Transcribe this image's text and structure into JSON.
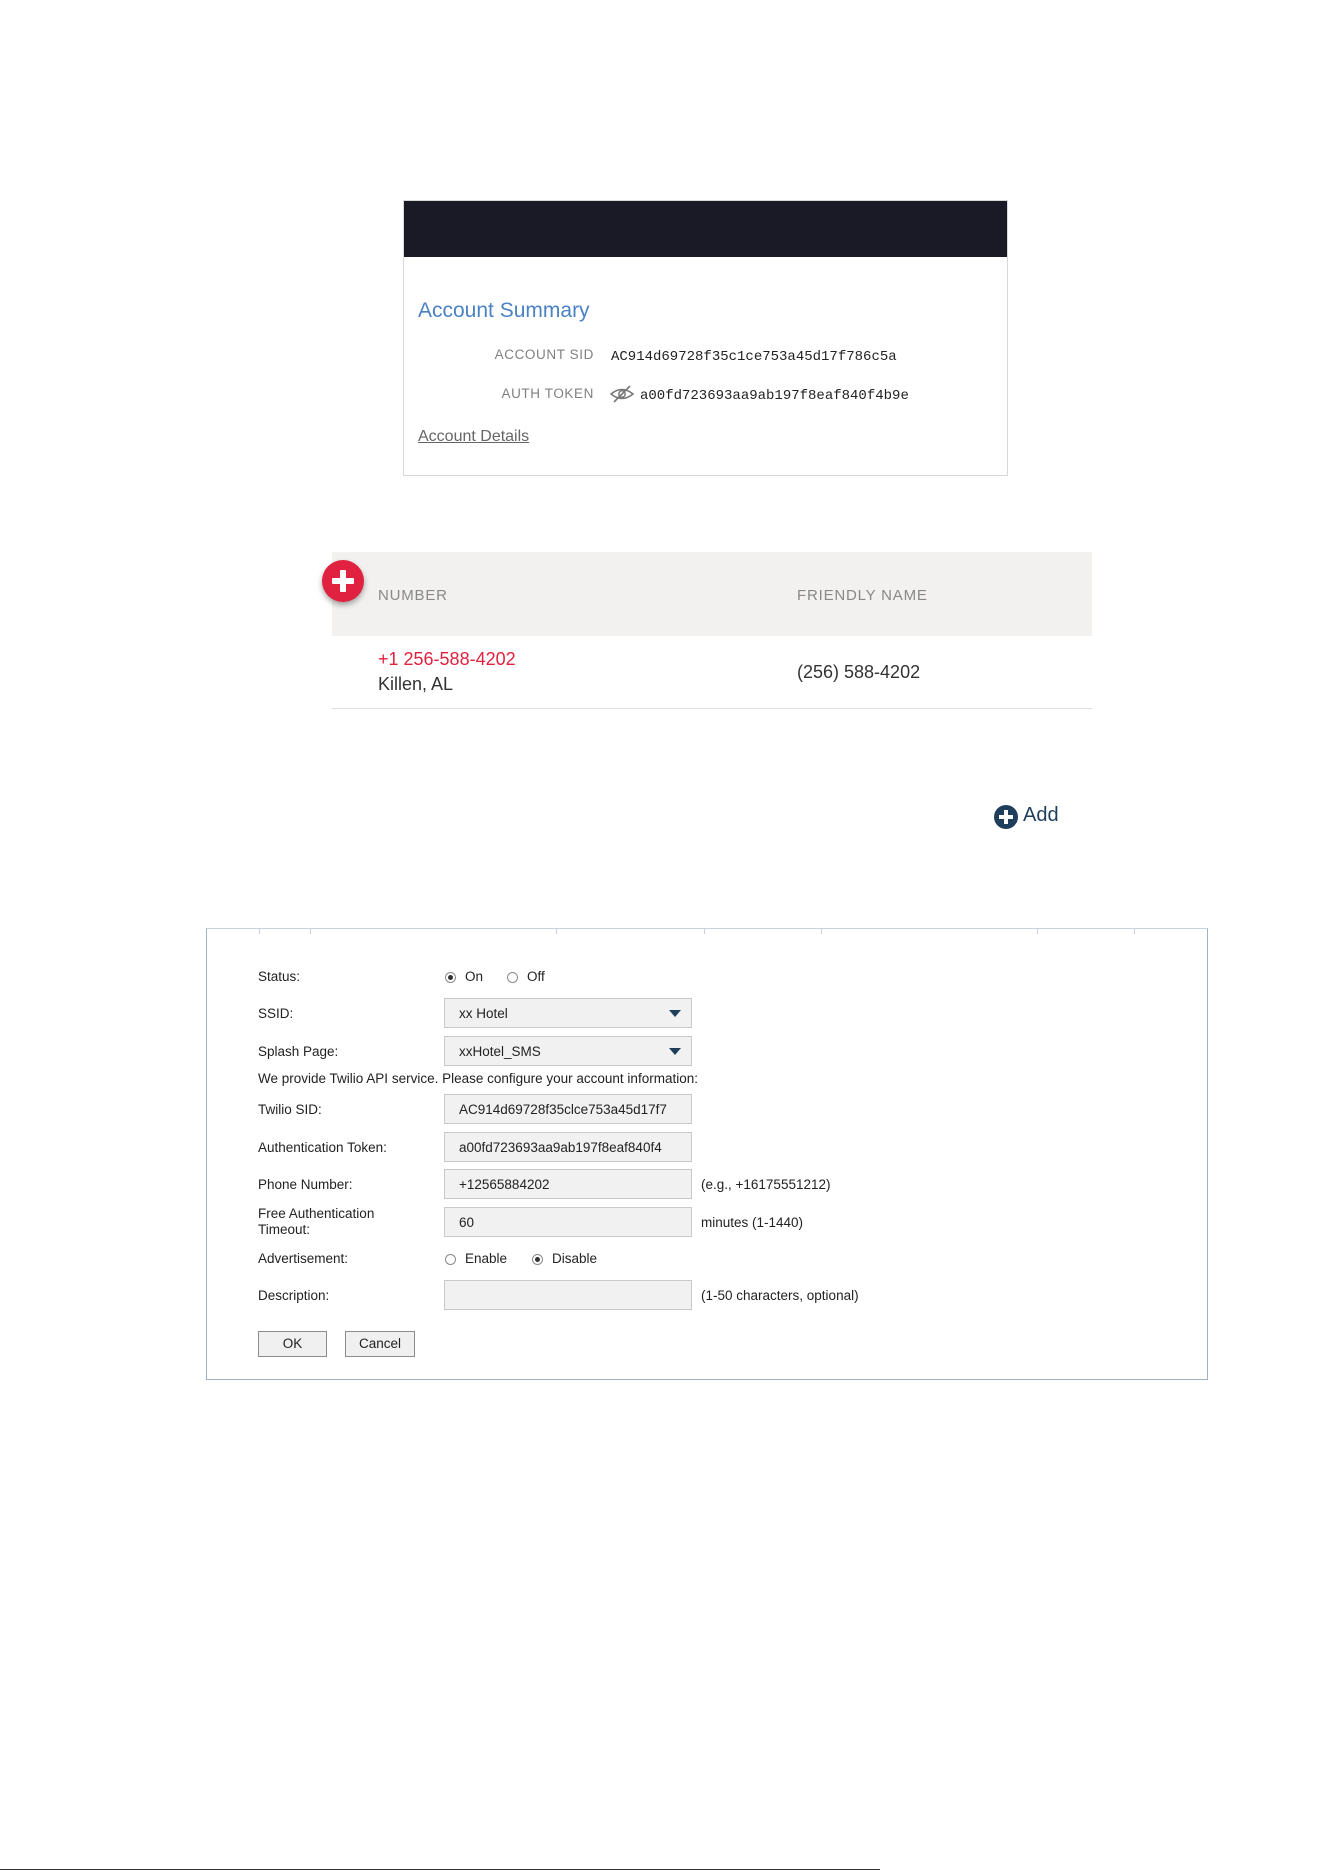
{
  "account": {
    "title": "Account Summary",
    "sid_label": "ACCOUNT SID",
    "sid_value": "AC914d69728f35c1ce753a45d17f786c5a",
    "token_label": "AUTH TOKEN",
    "token_value": "a00fd723693aa9ab197f8eaf840f4b9e",
    "token_visibility_icon": "eye-slash-icon",
    "details_link": "Account Details"
  },
  "numbers_table": {
    "add_icon": "plus-circle-icon",
    "columns": [
      "NUMBER",
      "FRIENDLY NAME"
    ],
    "rows": [
      {
        "number": "+1 256-588-4202",
        "location": "Killen, AL",
        "friendly_name": "(256) 588-4202"
      }
    ],
    "number_color": "#e0213f"
  },
  "add_button": {
    "icon": "plus-circle-icon",
    "label": "Add",
    "color": "#1f3e5c"
  },
  "portal_form": {
    "status": {
      "label": "Status:",
      "options": [
        "On",
        "Off"
      ],
      "selected": "On"
    },
    "ssid": {
      "label": "SSID:",
      "value": "xx Hotel"
    },
    "splash_page": {
      "label": "Splash Page:",
      "value": "xxHotel_SMS"
    },
    "notice": "We provide Twilio API service. Please configure your account information:",
    "twilio_sid": {
      "label": "Twilio SID:",
      "value": "AC914d69728f35clce753a45d17f7"
    },
    "auth_token": {
      "label": "Authentication Token:",
      "value": "a00fd723693aa9ab197f8eaf840f4"
    },
    "phone_number": {
      "label": "Phone Number:",
      "value": "+12565884202",
      "hint": "(e.g., +16175551212)"
    },
    "timeout": {
      "label_line1": "Free Authentication",
      "label_line2": "Timeout:",
      "value": "60",
      "hint": "minutes (1-1440)"
    },
    "advertisement": {
      "label": "Advertisement:",
      "options": [
        "Enable",
        "Disable"
      ],
      "selected": "Disable"
    },
    "description": {
      "label": "Description:",
      "value": "",
      "hint": "(1-50 characters, optional)"
    },
    "ok_button": "OK",
    "cancel_button": "Cancel"
  }
}
